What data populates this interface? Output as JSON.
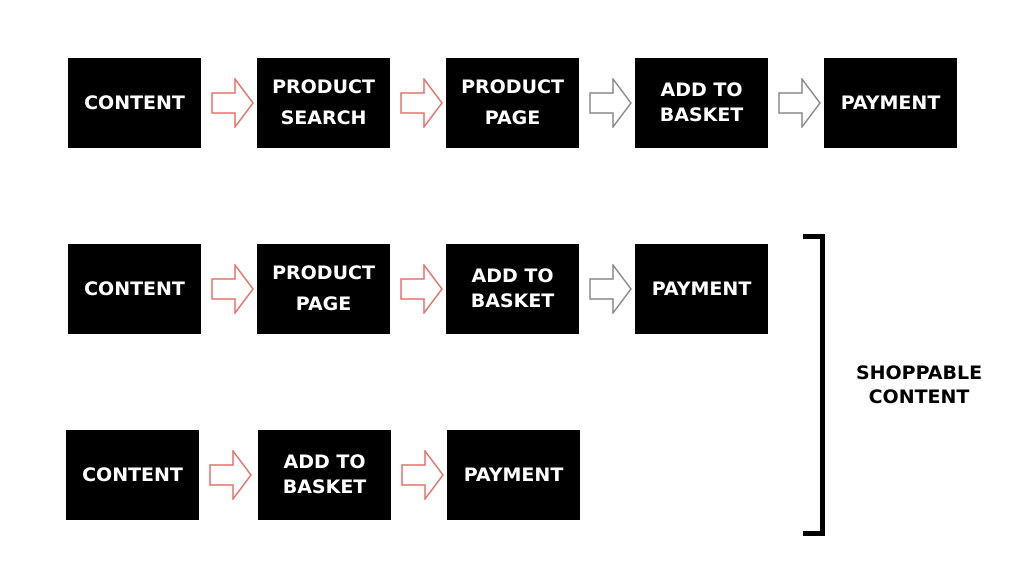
{
  "colors": {
    "box": "#000000",
    "box_text": "#ffffff",
    "arrow_red": "#e8706a",
    "arrow_gray": "#8a8a8a"
  },
  "rows": [
    {
      "steps": [
        "CONTENT",
        "PRODUCT SEARCH",
        "PRODUCT PAGE",
        "ADD TO BASKET",
        "PAYMENT"
      ],
      "arrows": [
        "red",
        "red",
        "gray",
        "gray"
      ]
    },
    {
      "steps": [
        "CONTENT",
        "PRODUCT PAGE",
        "ADD TO BASKET",
        "PAYMENT"
      ],
      "arrows": [
        "red",
        "red",
        "gray"
      ]
    },
    {
      "steps": [
        "CONTENT",
        "ADD TO BASKET",
        "PAYMENT"
      ],
      "arrows": [
        "red",
        "red"
      ]
    }
  ],
  "group_label": "SHOPPABLE CONTENT"
}
